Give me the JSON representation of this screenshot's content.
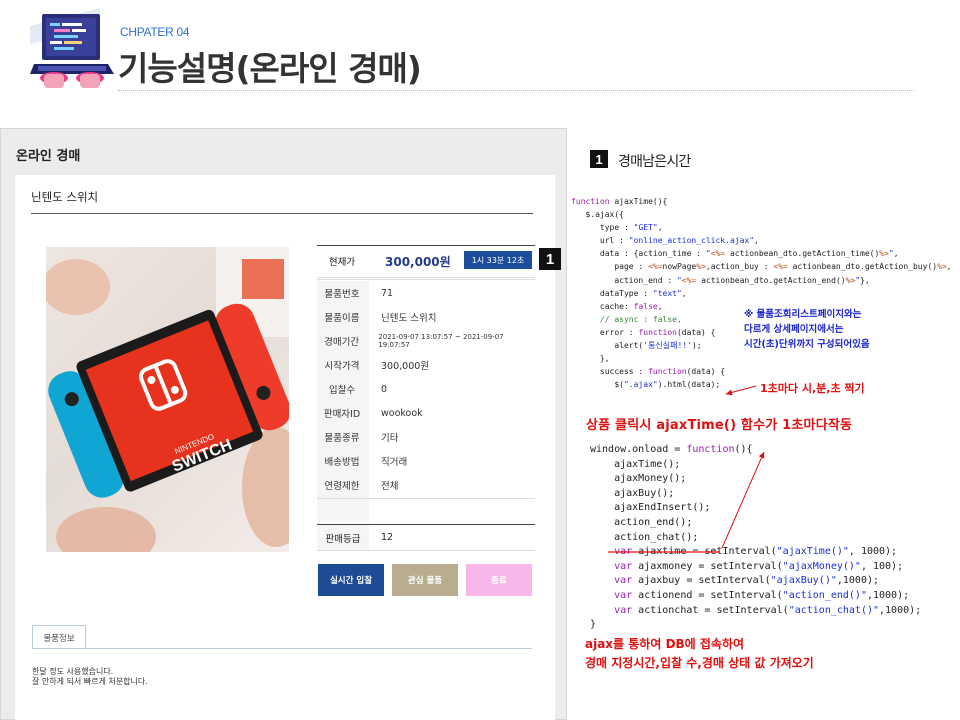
{
  "header": {
    "chapter": "CHPATER 04",
    "title": "기능설명(온라인 경매)"
  },
  "screenshot": {
    "page_title": "온라인 경매",
    "product_name": "닌텐도 스위치",
    "current_price_label": "현재가",
    "current_price": "300,000원",
    "remaining_time": "1시 33분 12초",
    "rows": [
      {
        "label": "물품번호",
        "value": "71"
      },
      {
        "label": "물품이름",
        "value": "닌텐도 스위치"
      },
      {
        "label": "경매기간",
        "value": "2021-09-07 13:07:57 ~ 2021-09-07 19:07:57"
      },
      {
        "label": "시작가격",
        "value": "300,000원"
      },
      {
        "label": "입찰수",
        "value": "0"
      },
      {
        "label": "판매자ID",
        "value": "wookook"
      },
      {
        "label": "물품종류",
        "value": "기타"
      },
      {
        "label": "배송방법",
        "value": "직거래"
      },
      {
        "label": "연령제한",
        "value": "전체"
      }
    ],
    "grade_label": "판매등급",
    "grade_value": "12",
    "buttons": {
      "bid": "실시간 입찰",
      "fav": "관심 물품",
      "end": "종료"
    },
    "tab_label": "물품정보",
    "description_line1": "한달 정도 사용했습니다.",
    "description_line2": "잘 안하게 되서 빠르게 처분합니다.",
    "photo_text_1": "NINTENDO",
    "photo_text_2": "SWITCH"
  },
  "markers": {
    "left": "1",
    "right": "1"
  },
  "section": {
    "title": "경매남은시간"
  },
  "notes": {
    "blue_line1": "※ 물품조회리스트페이지와는",
    "blue_line2": "다르게 상세페이지에서는",
    "blue_line3": "시간(초)단위까지 구성되어있음",
    "red_tick": "1초마다 시,분,초 찍기",
    "red_click": "상품 클릭시 ajaxTime() 함수가 1초마다작동",
    "red_db_line1": "ajax를 통하여 DB에 접속하여",
    "red_db_line2": "경매 지정시간,입찰 수,경매 상태 값 가져오기"
  },
  "colors": {
    "accent_blue": "#1d4e9e",
    "note_red": "#e01010",
    "note_blue": "#1a25d0"
  }
}
